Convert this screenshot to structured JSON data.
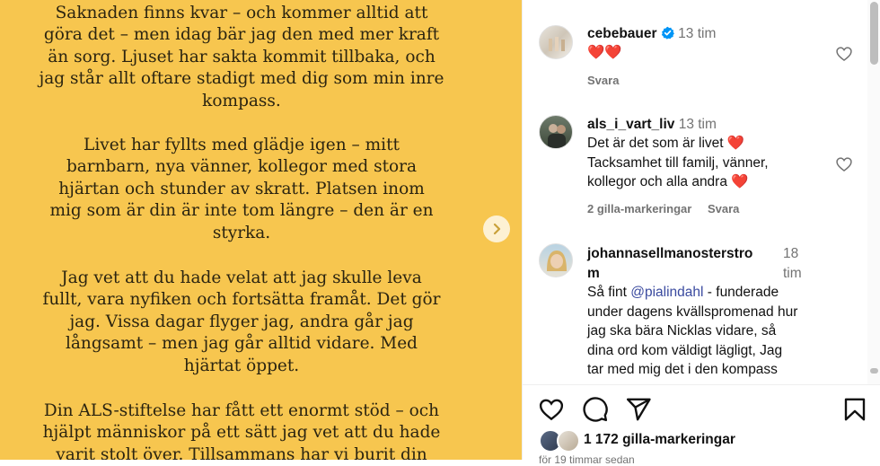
{
  "post_image": {
    "paragraphs": [
      "Saknaden finns kvar – och kommer alltid att\ngöra det – men idag bär jag den med mer kraft\nän sorg. Ljuset har sakta kommit tillbaka, och\njag står allt oftare stadigt med dig som min inre\nkompass.",
      "Livet har fyllts med glädje igen – mitt\nbarnbarn, nya vänner, kollegor med stora\nhjärtan och stunder av skratt. Platsen inom\nmig som är din är inte tom längre – den är en\nstyrka.",
      "Jag vet att du hade velat att jag skulle leva\nfullt, vara nyfiken och fortsätta framåt. Det gör\njag. Vissa dagar flyger jag, andra går jag\nlångsamt – men jag går alltid vidare. Med\nhjärtat öppet.",
      "Din ALS-stiftelse har fått ett enormt stöd – och\nhjälpt människor på ett sätt jag vet att du hade\nvarit stolt över. Tillsammans har vi burit din"
    ],
    "background_color": "#f7c64f"
  },
  "comments": [
    {
      "username": "cebebauer",
      "verified": true,
      "time": "13 tim",
      "text": "❤️❤️",
      "reply_label": "Svara"
    },
    {
      "username": "als_i_vart_liv",
      "time": "13 tim",
      "text_lines": [
        "Det är det som är livet ❤️",
        "Tacksamhet till familj, vänner,",
        "kollegor och alla andra ❤️"
      ],
      "likes_label": "2 gilla-markeringar",
      "reply_label": "Svara"
    },
    {
      "username_line1": "johannasellmanosterstro",
      "username_line2": "m",
      "time_line1": "18",
      "time_line2": "tim",
      "text_before_mention": "Så fint ",
      "mention": "@pialindahl",
      "text_after_mention": " - funderade",
      "text_lines": [
        "under dagens kvällspromenad hur",
        "jag ska bära Nicklas vidare, så",
        "dina ord kom väldigt lägligt, Jag",
        "tar med mig det i den kompass"
      ]
    }
  ],
  "actions": {
    "icons": [
      "heart-outline-icon",
      "comment-bubble-icon",
      "share-send-icon",
      "bookmark-icon"
    ]
  },
  "likes": {
    "count_label": "1 172 gilla-markeringar"
  },
  "date_label": "för 19 timmar sedan",
  "colors": {
    "accent_verified": "#0095f6",
    "mention": "#3a4a9f",
    "meta_gray": "#737373"
  }
}
